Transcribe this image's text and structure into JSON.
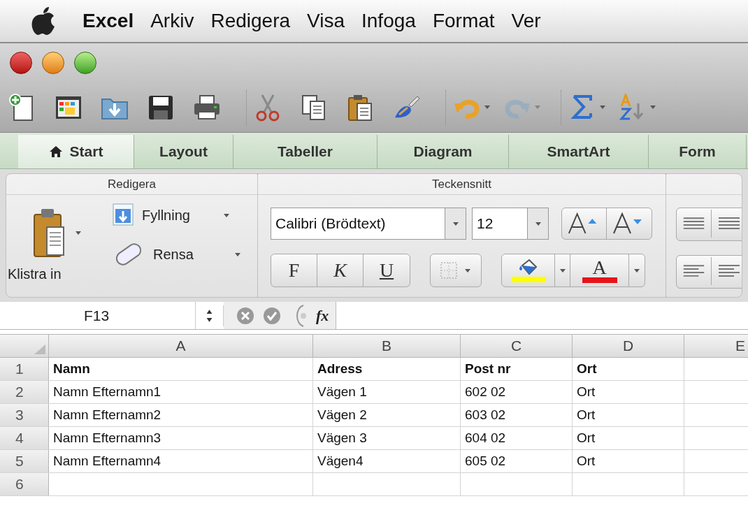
{
  "menu_bar": {
    "items": [
      {
        "label": "Excel",
        "kind": "app"
      },
      {
        "label": "Arkiv",
        "kind": "menu"
      },
      {
        "label": "Redigera",
        "kind": "menu"
      },
      {
        "label": "Visa",
        "kind": "menu"
      },
      {
        "label": "Infoga",
        "kind": "menu"
      },
      {
        "label": "Format",
        "kind": "menu"
      },
      {
        "label": "Ver",
        "kind": "menu"
      }
    ]
  },
  "toolbar": [
    {
      "kind": "new",
      "caret": false,
      "disabled": false
    },
    {
      "kind": "gallery",
      "caret": false,
      "disabled": false
    },
    {
      "kind": "open",
      "caret": false,
      "disabled": false
    },
    {
      "kind": "save",
      "caret": false,
      "disabled": false
    },
    {
      "kind": "print",
      "caret": false,
      "disabled": false
    },
    {
      "kind": "cut",
      "caret": false,
      "disabled": false
    },
    {
      "kind": "copy",
      "caret": false,
      "disabled": false
    },
    {
      "kind": "paste",
      "caret": false,
      "disabled": false
    },
    {
      "kind": "brush",
      "caret": false,
      "disabled": false
    },
    {
      "kind": "undo",
      "caret": true,
      "disabled": false
    },
    {
      "kind": "redo",
      "caret": true,
      "disabled": true
    },
    {
      "kind": "sum",
      "caret": true,
      "disabled": false
    },
    {
      "kind": "sort",
      "caret": true,
      "disabled": false
    }
  ],
  "tabs": [
    {
      "label": "Start",
      "selected": true
    },
    {
      "label": "Layout",
      "selected": false
    },
    {
      "label": "Tabeller",
      "selected": false
    },
    {
      "label": "Diagram",
      "selected": false
    },
    {
      "label": "SmartArt",
      "selected": false
    },
    {
      "label": "Form",
      "selected": false
    }
  ],
  "ribbon": {
    "edit_group": {
      "title": "Redigera",
      "paste_label": "Klistra in",
      "fill_label": "Fyllning",
      "clear_label": "Rensa"
    },
    "font_group": {
      "title": "Teckensnitt",
      "font_name": "Calibri (Brödtext)",
      "font_size": "12",
      "bold_label": "F",
      "italic_label": "K",
      "underline_label": "U",
      "font_color_letter": "A",
      "color_buttons": [
        {
          "kind": "fill",
          "color": "#ffff00"
        },
        {
          "kind": "font",
          "color": "#e8121b"
        }
      ]
    }
  },
  "formula_bar": {
    "name_box": "F13",
    "fx_label": "fx"
  },
  "sheet": {
    "columns": [
      "A",
      "B",
      "C",
      "D",
      "E"
    ],
    "rows": [
      {
        "number": "1",
        "cells": [
          "Namn",
          "Adress",
          "Post nr",
          "Ort"
        ],
        "bold": true
      },
      {
        "number": "2",
        "cells": [
          "Namn Efternamn1",
          "Vägen 1",
          "602 02",
          "Ort"
        ],
        "bold": false
      },
      {
        "number": "3",
        "cells": [
          "Namn Efternamn2",
          "Vägen 2",
          "603 02",
          "Ort"
        ],
        "bold": false
      },
      {
        "number": "4",
        "cells": [
          "Namn Efternamn3",
          "Vägen 3",
          "604 02",
          "Ort"
        ],
        "bold": false
      },
      {
        "number": "5",
        "cells": [
          "Namn Efternamn4",
          "Vägen4",
          "605 02",
          "Ort"
        ],
        "bold": false
      },
      {
        "number": "6",
        "cells": []
      }
    ]
  }
}
